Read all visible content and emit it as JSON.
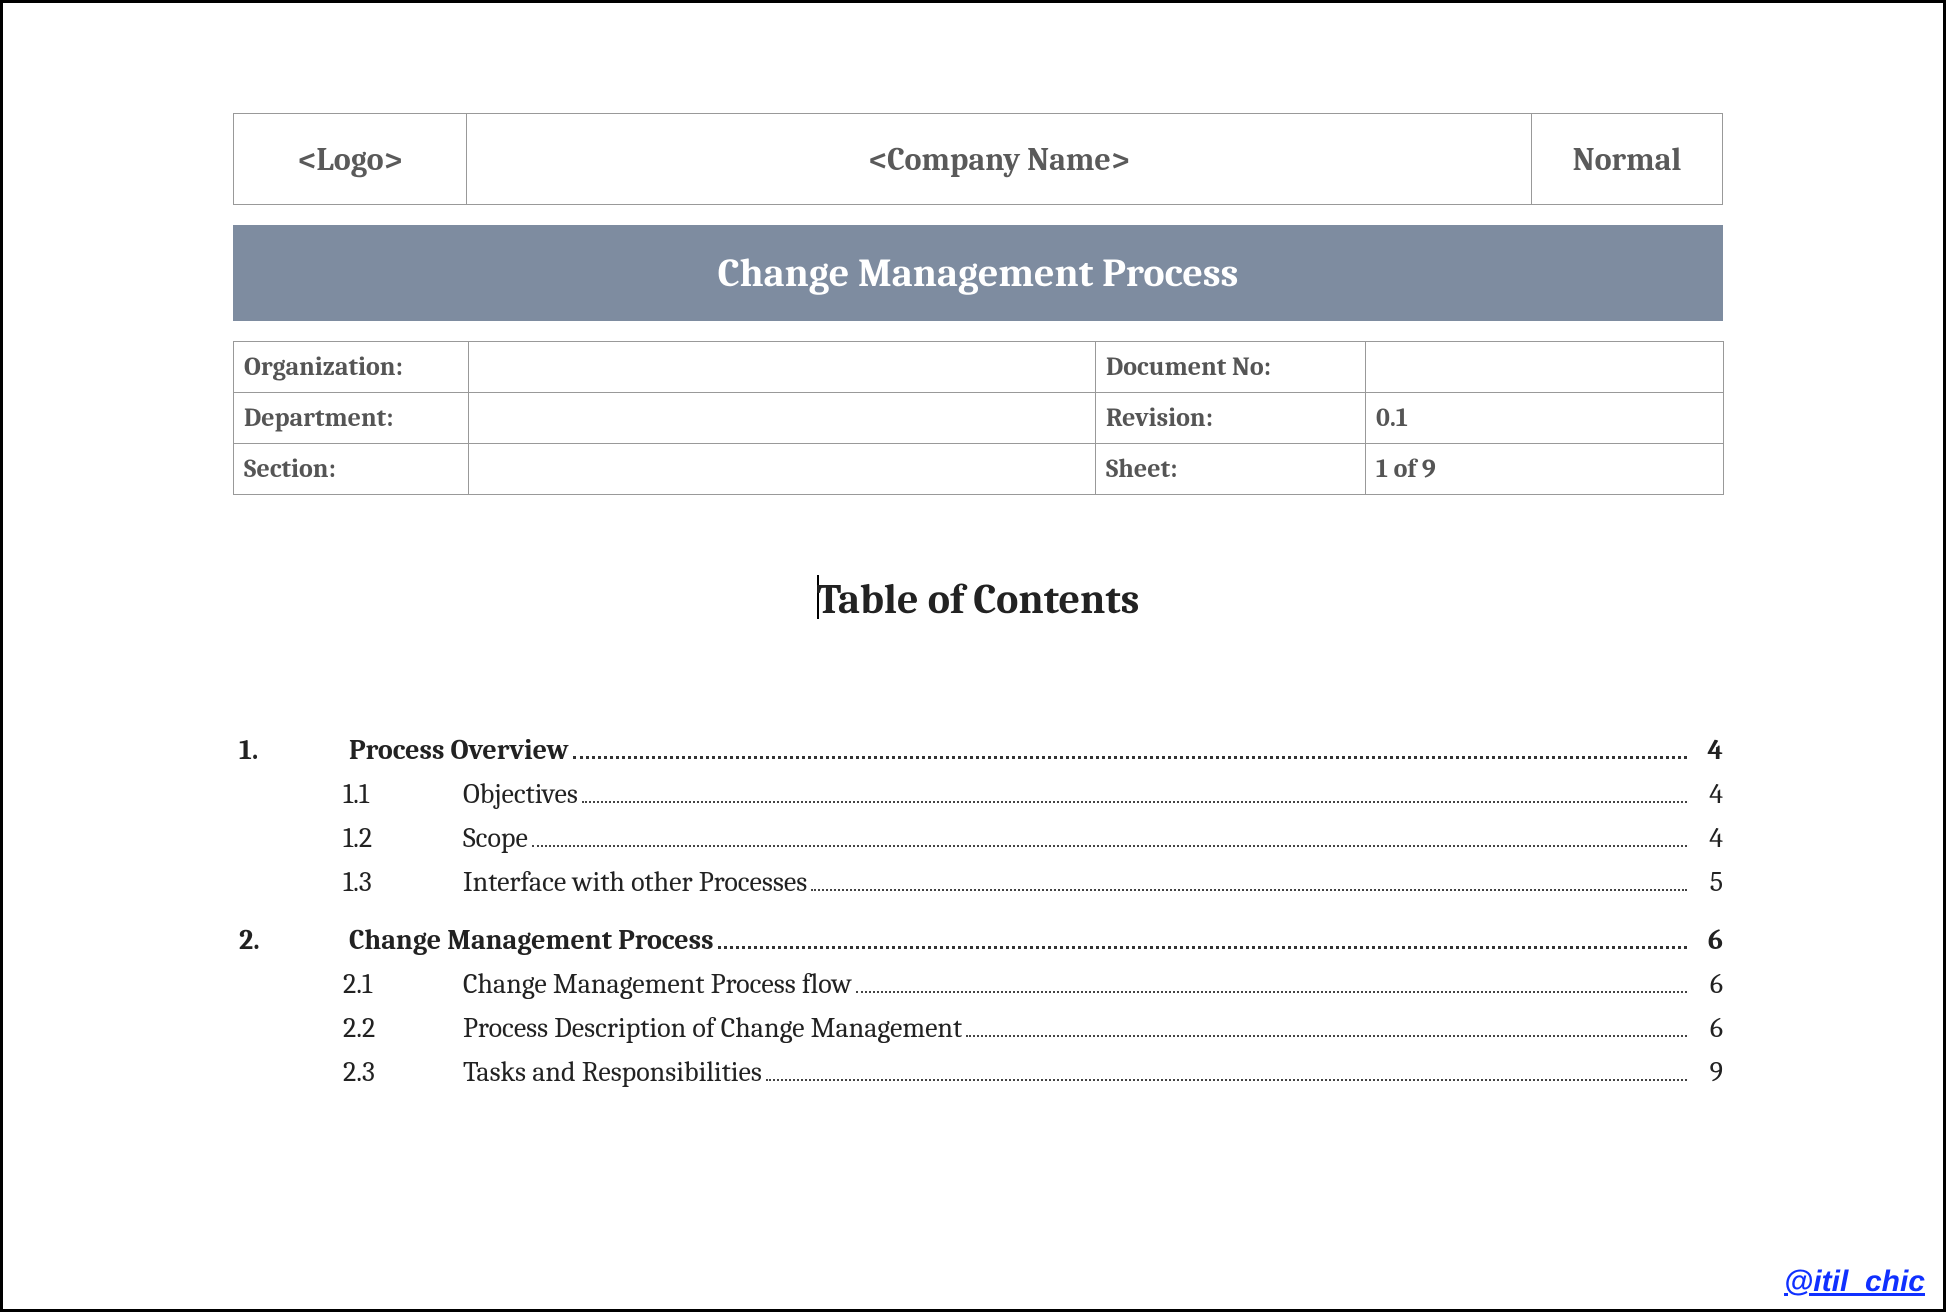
{
  "header": {
    "logo": "<Logo>",
    "company": "<Company Name>",
    "type": "Normal"
  },
  "title": "Change Management Process",
  "meta": {
    "labels": {
      "organization": "Organization:",
      "department": "Department:",
      "section": "Section:",
      "document_no": "Document No:",
      "revision": "Revision:",
      "sheet": "Sheet:"
    },
    "values": {
      "organization": "",
      "department": "",
      "section": "",
      "document_no": "",
      "revision": "0.1",
      "sheet": "1 of 9"
    }
  },
  "toc_title": "Table of Contents",
  "toc": [
    {
      "level": 1,
      "num": "1.",
      "text": "Process Overview",
      "page": "4"
    },
    {
      "level": 2,
      "num": "1.1",
      "text": "Objectives",
      "page": "4"
    },
    {
      "level": 2,
      "num": "1.2",
      "text": "Scope",
      "page": "4"
    },
    {
      "level": 2,
      "num": "1.3",
      "text": "Interface with other Processes",
      "page": "5"
    },
    {
      "level": 1,
      "num": "2.",
      "text": "Change Management Process",
      "page": "6"
    },
    {
      "level": 2,
      "num": "2.1",
      "text": "Change Management Process flow",
      "page": "6"
    },
    {
      "level": 2,
      "num": "2.2",
      "text": "Process Description of Change Management",
      "page": "6"
    },
    {
      "level": 2,
      "num": "2.3",
      "text": "Tasks and Responsibilities",
      "page": "9"
    }
  ],
  "watermark": "@itil_chic"
}
